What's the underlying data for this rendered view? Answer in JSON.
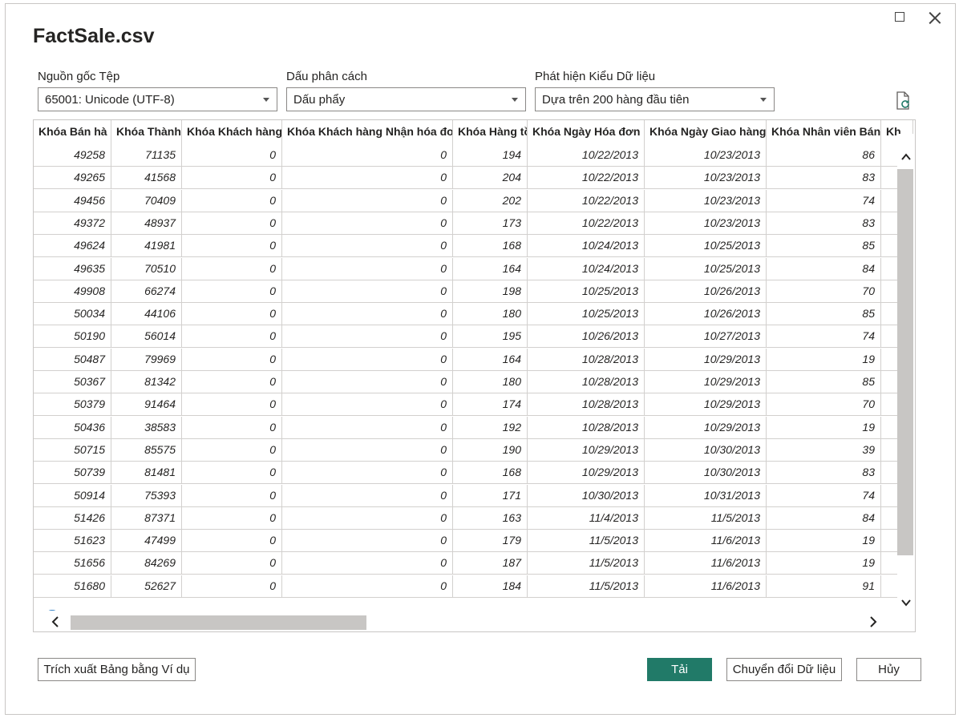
{
  "dialog": {
    "title": "FactSale.csv"
  },
  "file_origin": {
    "label": "Nguồn gốc Tệp",
    "value": "65001: Unicode (UTF-8)"
  },
  "delimiter": {
    "label": "Dấu phân cách",
    "value": "Dấu phẩy"
  },
  "data_type_detection": {
    "label": "Phát hiện Kiểu Dữ liệu",
    "value": "Dựa trên 200 hàng đầu tiên"
  },
  "table": {
    "columns": [
      "Khóa Bán hà",
      "Khóa Thành",
      "Khóa Khách hàng",
      "Khóa Khách hàng Nhận hóa đơ",
      "Khóa Hàng tồ",
      "Khóa Ngày Hóa đơn",
      "Khóa Ngày Giao hàng",
      "Khóa Nhân viên Bán",
      "Kh"
    ],
    "rows": [
      [
        "49258",
        "71135",
        "0",
        "0",
        "194",
        "10/22/2013",
        "10/23/2013",
        "86"
      ],
      [
        "49265",
        "41568",
        "0",
        "0",
        "204",
        "10/22/2013",
        "10/23/2013",
        "83"
      ],
      [
        "49456",
        "70409",
        "0",
        "0",
        "202",
        "10/22/2013",
        "10/23/2013",
        "74"
      ],
      [
        "49372",
        "48937",
        "0",
        "0",
        "173",
        "10/22/2013",
        "10/23/2013",
        "83"
      ],
      [
        "49624",
        "41981",
        "0",
        "0",
        "168",
        "10/24/2013",
        "10/25/2013",
        "85"
      ],
      [
        "49635",
        "70510",
        "0",
        "0",
        "164",
        "10/24/2013",
        "10/25/2013",
        "84"
      ],
      [
        "49908",
        "66274",
        "0",
        "0",
        "198",
        "10/25/2013",
        "10/26/2013",
        "70"
      ],
      [
        "50034",
        "44106",
        "0",
        "0",
        "180",
        "10/25/2013",
        "10/26/2013",
        "85"
      ],
      [
        "50190",
        "56014",
        "0",
        "0",
        "195",
        "10/26/2013",
        "10/27/2013",
        "74"
      ],
      [
        "50487",
        "79969",
        "0",
        "0",
        "164",
        "10/28/2013",
        "10/29/2013",
        "19"
      ],
      [
        "50367",
        "81342",
        "0",
        "0",
        "180",
        "10/28/2013",
        "10/29/2013",
        "85"
      ],
      [
        "50379",
        "91464",
        "0",
        "0",
        "174",
        "10/28/2013",
        "10/29/2013",
        "70"
      ],
      [
        "50436",
        "38583",
        "0",
        "0",
        "192",
        "10/28/2013",
        "10/29/2013",
        "19"
      ],
      [
        "50715",
        "85575",
        "0",
        "0",
        "190",
        "10/29/2013",
        "10/30/2013",
        "39"
      ],
      [
        "50739",
        "81481",
        "0",
        "0",
        "168",
        "10/29/2013",
        "10/30/2013",
        "83"
      ],
      [
        "50914",
        "75393",
        "0",
        "0",
        "171",
        "10/30/2013",
        "10/31/2013",
        "74"
      ],
      [
        "51426",
        "87371",
        "0",
        "0",
        "163",
        "11/4/2013",
        "11/5/2013",
        "84"
      ],
      [
        "51623",
        "47499",
        "0",
        "0",
        "179",
        "11/5/2013",
        "11/6/2013",
        "19"
      ],
      [
        "51656",
        "84269",
        "0",
        "0",
        "187",
        "11/5/2013",
        "11/6/2013",
        "19"
      ],
      [
        "51680",
        "52627",
        "0",
        "0",
        "184",
        "11/5/2013",
        "11/6/2013",
        "91"
      ]
    ]
  },
  "buttons": {
    "extract": "Trích xuất Bảng bằng Ví dụ",
    "load": "Tải",
    "transform": "Chuyển đổi Dữ liệu",
    "cancel": "Hủy"
  },
  "colors": {
    "primary": "#217a68",
    "border": "#8a8886",
    "grid_line": "#d2d0ce",
    "scroll_thumb": "#c8c6c4"
  },
  "icons": {
    "maximize": "maximize-icon",
    "close": "close-icon",
    "refresh": "refresh-file-icon"
  }
}
